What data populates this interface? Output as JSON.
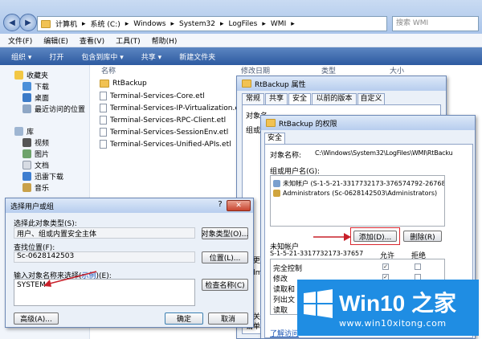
{
  "explorer": {
    "breadcrumb": [
      "计算机",
      "系统 (C:)",
      "Windows",
      "System32",
      "LogFiles",
      "WMI"
    ],
    "search_placeholder": "搜索 WMI",
    "menu": [
      "文件(F)",
      "编辑(E)",
      "查看(V)",
      "工具(T)",
      "帮助(H)"
    ],
    "toolbar": [
      "组织 ▾",
      "打开",
      "包含到库中 ▾",
      "共享 ▾",
      "新建文件夹"
    ],
    "columns": {
      "name": "名称",
      "modified": "修改日期",
      "type": "类型",
      "size": "大小"
    },
    "sidebar": {
      "favorites": "收藏夹",
      "fav_items": [
        "下载",
        "桌面",
        "最近访问的位置"
      ],
      "libraries": "库",
      "lib_items": [
        "视频",
        "图片",
        "文档",
        "迅雷下载",
        "音乐"
      ]
    },
    "files": [
      "RtBackup",
      "Terminal-Services-Core.etl",
      "Terminal-Services-IP-Virtualization.etl",
      "Terminal-Services-RPC-Client.etl",
      "Terminal-Services-SessionEnv.etl",
      "Terminal-Services-Unified-APIs.etl"
    ]
  },
  "props_dialog": {
    "title": "RtBackup 属性",
    "tabs": [
      "常规",
      "共享",
      "安全",
      "以前的版本",
      "自定义"
    ],
    "object_prefix": "对象名",
    "hint_prefix": "组或",
    "edit_prefix": "要更",
    "perm_prefix": "Adm",
    "special_prefix": "有关",
    "special_line2": "请单"
  },
  "perm_dialog": {
    "title": "RtBackup 的权限",
    "tab": "安全",
    "object_label": "对象名称:",
    "object_value": "C:\\Windows\\System32\\LogFiles\\WMI\\RtBacku",
    "group_label": "组或用户名(G):",
    "users": [
      "未知帐户 (S-1-5-21-3317732173-376574792-267687",
      "Administrators (Sc-0628142503\\Administrators)"
    ],
    "add_button": "添加(D)...",
    "remove_button": "删除(R)",
    "perm_for": "未知帐户",
    "perm_for_sid": "S-1-5-21-3317732173-37657",
    "allow": "允许",
    "deny": "拒绝",
    "perms": [
      "完全控制",
      "修改",
      "读取和",
      "列出文",
      "读取"
    ],
    "link": "了解访问"
  },
  "select_dialog": {
    "title": "选择用户或组",
    "help": "?",
    "type_label": "选择此对象类型(S):",
    "type_value": "用户、组或内置安全主体",
    "type_button": "对象类型(O)...",
    "location_label": "查找位置(F):",
    "location_value": "Sc-0628142503",
    "location_button": "位置(L)...",
    "names_label_pre": "输入对象名称来选择(",
    "names_label_link": "示例",
    "names_label_post": ")(E):",
    "names_value": "SYSTEM",
    "check_button": "检查名称(C)",
    "advanced_button": "高级(A)...",
    "ok_button": "确定",
    "cancel_button": "取消"
  },
  "watermark": {
    "brand": "Win10 之家",
    "url": "www.win10xitong.com"
  },
  "colors": {
    "accent": "#1f8de3",
    "arrow": "#c8202a"
  }
}
